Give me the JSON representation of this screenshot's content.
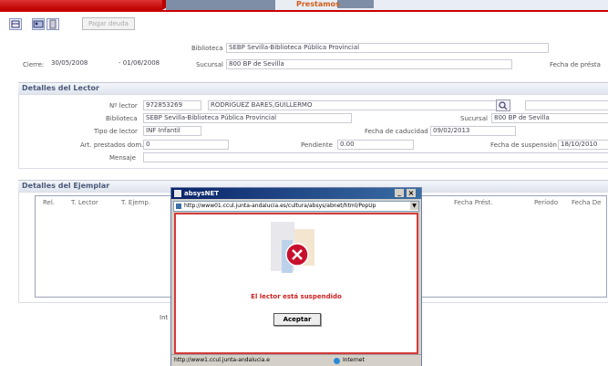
{
  "app": {
    "left_tab": "",
    "active_tab": "Prestamos"
  },
  "toolbar": {
    "button_label": "Pagar deuda"
  },
  "loan": {
    "biblioteca_label": "Biblioteca",
    "biblioteca_value": "SEBP Sevilla-Biblioteca Pública Provincial",
    "cierre_label": "Cierre:",
    "cierre_from": "30/05/2008",
    "cierre_to": "- 01/06/2008",
    "sucursal_label": "Sucursal",
    "sucursal_value": "800 BP de Sevilla",
    "fecha_prestamo_label": "Fecha de présta"
  },
  "lector": {
    "section_title": "Detalles del Lector",
    "numero_label": "Nº lector",
    "numero_value": "972853269",
    "nombre_value": "RODRIGUEZ BARES,GUILLERMO",
    "biblioteca_label": "Biblioteca",
    "biblioteca_value": "SEBP Sevilla-Biblioteca Pública Provincial",
    "sucursal_label": "Sucursal",
    "sucursal_value": "800 BP de Sevilla",
    "tipo_label": "Tipo de lector",
    "tipo_value": "INF Infantil",
    "caducidad_label": "Fecha de caducidad",
    "caducidad_value": "09/02/2013",
    "art_label": "Art. prestados dom.",
    "art_value": "0",
    "pendiente_label": "Pendiente",
    "pendiente_value": "0.00",
    "suspension_label": "Fecha de suspensión",
    "suspension_value": "18/10/2010",
    "mensaje_label": "Mensaje"
  },
  "ejemplar": {
    "section_title": "Detalles del Ejemplar",
    "columns": [
      "Rel.",
      "T. Lector",
      "T. Ejemp.",
      "Fecha Prést.",
      "Período",
      "Fecha De"
    ]
  },
  "footer_text": "Int",
  "popup": {
    "title": "absysNET",
    "close": "×",
    "min": "_",
    "address": "http://www01.ccul.junta-andalucia.es/cultura/absys/abnet/html/PopUp",
    "message": "El lector está suspendido",
    "button": "Aceptar",
    "status_url": "http://www1.ccul.junta-andalucia.e",
    "status_zone": "Internet",
    "accent": "#cc2222"
  }
}
